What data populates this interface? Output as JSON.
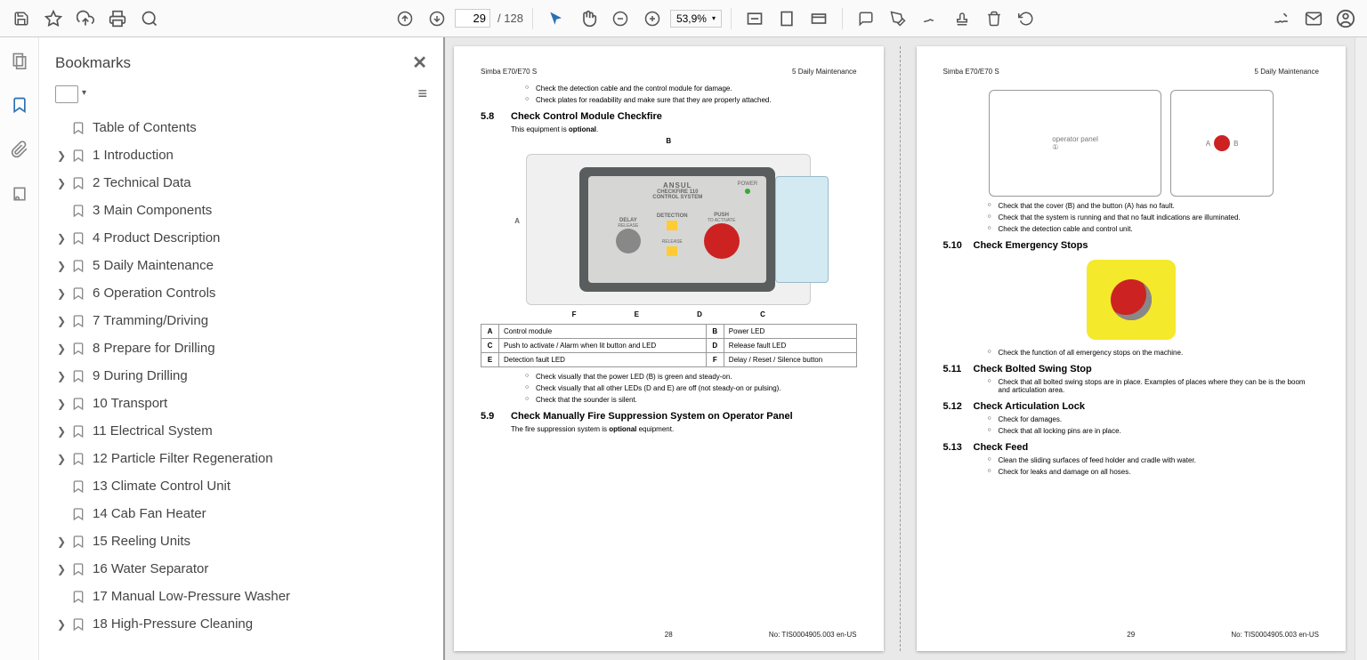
{
  "toolbar": {
    "page_current": "29",
    "page_total": "/ 128",
    "zoom": "53,9%"
  },
  "sidebar": {
    "title": "Bookmarks",
    "items": [
      {
        "label": "Table of Contents",
        "expandable": false
      },
      {
        "label": "1 Introduction",
        "expandable": true
      },
      {
        "label": "2 Technical Data",
        "expandable": true
      },
      {
        "label": "3 Main Components",
        "expandable": false
      },
      {
        "label": "4 Product Description",
        "expandable": true
      },
      {
        "label": "5 Daily Maintenance",
        "expandable": true
      },
      {
        "label": "6 Operation Controls",
        "expandable": true
      },
      {
        "label": "7 Tramming/Driving",
        "expandable": true
      },
      {
        "label": "8 Prepare for Drilling",
        "expandable": true
      },
      {
        "label": "9 During Drilling",
        "expandable": true
      },
      {
        "label": "10 Transport",
        "expandable": true
      },
      {
        "label": "11 Electrical System",
        "expandable": true
      },
      {
        "label": "12 Particle Filter Regeneration",
        "expandable": true
      },
      {
        "label": "13 Climate Control Unit",
        "expandable": false
      },
      {
        "label": "14 Cab Fan Heater",
        "expandable": false
      },
      {
        "label": "15 Reeling Units",
        "expandable": true
      },
      {
        "label": "16 Water Separator",
        "expandable": true
      },
      {
        "label": "17 Manual Low-Pressure Washer",
        "expandable": false
      },
      {
        "label": "18 High-Pressure Cleaning",
        "expandable": true
      }
    ]
  },
  "pageLeft": {
    "hdr_l": "Simba E70/E70 S",
    "hdr_r": "5 Daily Maintenance",
    "top_checks": [
      "Check the detection cable and the control module for damage.",
      "Check plates for readability and make sure that they are properly attached."
    ],
    "s58_num": "5.8",
    "s58_title": "Check Control Module Checkfire",
    "s58_txt": "This equipment is ",
    "s58_bold": "optional",
    "s58_tail": ".",
    "module": {
      "brand": "ANSUL",
      "line2": "CHECKFIRE 110",
      "line3": "CONTROL SYSTEM",
      "power": "POWER",
      "delay": "DELAY",
      "delay2": "RELEASE",
      "detect": "DETECTION",
      "push": "PUSH",
      "push2": "TO ACTIVATE",
      "release": "RELEASE"
    },
    "callouts_top": "B",
    "callouts_left": "A",
    "call_row": [
      "F",
      "E",
      "D",
      "C"
    ],
    "legend": [
      [
        "A",
        "Control module",
        "B",
        "Power LED"
      ],
      [
        "C",
        "Push to activate / Alarm when lit button and LED",
        "D",
        "Release fault LED"
      ],
      [
        "E",
        "Detection fault LED",
        "F",
        "Delay / Reset / Silence button"
      ]
    ],
    "s58_checks": [
      "Check visually that the power LED (B) is green and steady-on.",
      "Check visually that all other LEDs (D and E) are off (not steady-on or pulsing).",
      "Check that the sounder is silent."
    ],
    "s59_num": "5.9",
    "s59_title": "Check Manually Fire Suppression System on Operator Panel",
    "s59_txt": "The fire suppression system is ",
    "s59_bold": "optional",
    "s59_tail": " equipment.",
    "ftr_num": "28",
    "ftr_doc": "No: TIS0004905.003 en-US"
  },
  "pageRight": {
    "hdr_l": "Simba E70/E70 S",
    "hdr_r": "5 Daily Maintenance",
    "joy_checks": [
      "Check that the cover (B) and the button (A) has no fault.",
      "Check that the system is running and that no fault indications are illuminated.",
      "Check the detection cable and control unit."
    ],
    "s510_num": "5.10",
    "s510_title": "Check Emergency Stops",
    "s510_checks": [
      "Check the function of all emergency stops on the machine."
    ],
    "s511_num": "5.11",
    "s511_title": "Check Bolted Swing Stop",
    "s511_checks": [
      "Check that all bolted swing stops are in place. Examples of places where they can be is the boom and articulation area."
    ],
    "s512_num": "5.12",
    "s512_title": "Check Articulation Lock",
    "s512_checks": [
      "Check for damages.",
      "Check that all locking pins are in place."
    ],
    "s513_num": "5.13",
    "s513_title": "Check Feed",
    "s513_checks": [
      "Clean the sliding surfaces of feed holder and cradle with water.",
      "Check for leaks and damage on all hoses."
    ],
    "ftr_num": "29",
    "ftr_doc": "No: TIS0004905.003 en-US"
  }
}
